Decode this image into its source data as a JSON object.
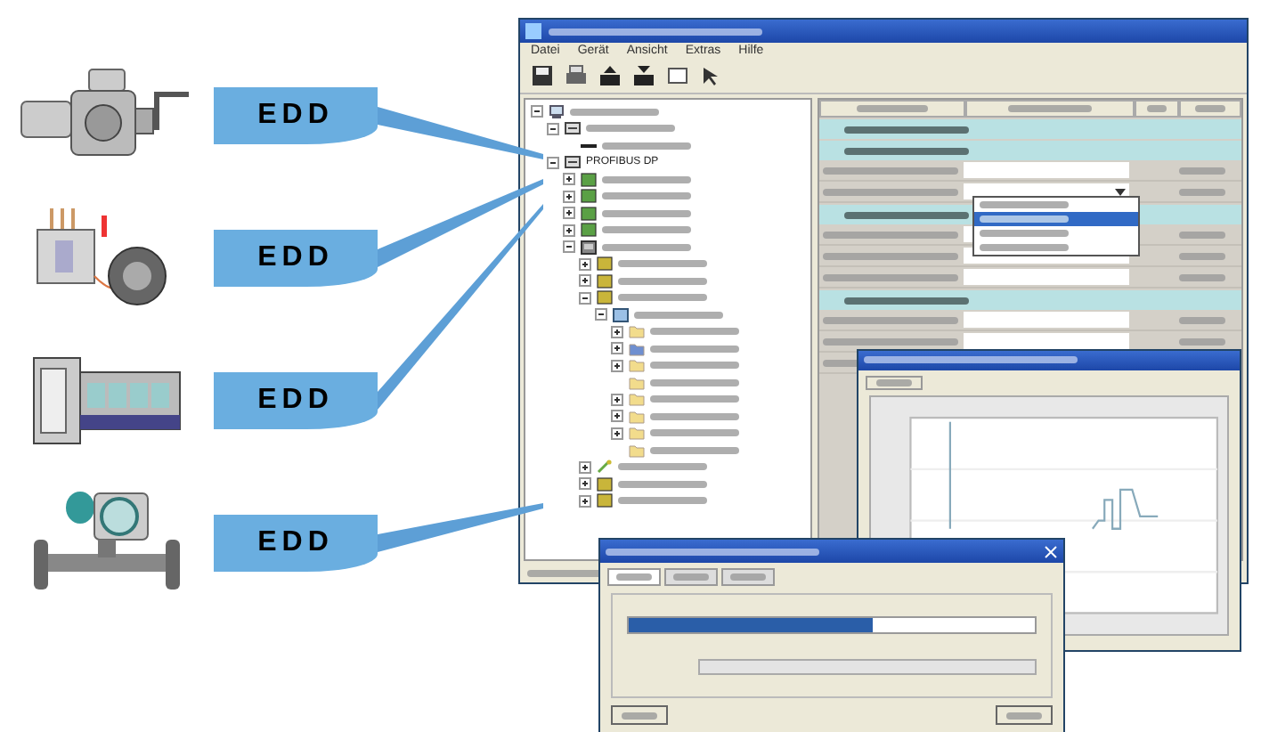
{
  "devices": [
    {
      "kind": "actuator",
      "label": "EDD"
    },
    {
      "kind": "motor-starter",
      "label": "EDD"
    },
    {
      "kind": "controller",
      "label": "EDD"
    },
    {
      "kind": "flowmeter",
      "label": "EDD"
    }
  ],
  "window": {
    "menu": [
      "Datei",
      "Gerät",
      "Ansicht",
      "Extras",
      "Hilfe"
    ],
    "tree": [
      {
        "kind": "computer",
        "expanded": true,
        "children": [
          {
            "kind": "network",
            "expanded": true,
            "children": [
              {
                "kind": "cable"
              }
            ]
          },
          {
            "kind": "network",
            "label": "PROFIBUS DP",
            "expanded": true,
            "children": [
              {
                "kind": "device",
                "expanded": false
              },
              {
                "kind": "device",
                "expanded": false
              },
              {
                "kind": "device",
                "expanded": false
              },
              {
                "kind": "device",
                "expanded": false
              },
              {
                "kind": "station",
                "expanded": true,
                "children": [
                  {
                    "kind": "module",
                    "expanded": false
                  },
                  {
                    "kind": "module",
                    "expanded": false
                  },
                  {
                    "kind": "module",
                    "expanded": true,
                    "children": [
                      {
                        "kind": "slave",
                        "expanded": true,
                        "children": [
                          {
                            "kind": "folder",
                            "expanded": false
                          },
                          {
                            "kind": "blue-folder",
                            "expanded": false
                          },
                          {
                            "kind": "folder",
                            "expanded": false
                          },
                          {
                            "kind": "folder"
                          },
                          {
                            "kind": "folder",
                            "expanded": false
                          },
                          {
                            "kind": "folder",
                            "expanded": false
                          },
                          {
                            "kind": "folder",
                            "expanded": false
                          },
                          {
                            "kind": "folder"
                          }
                        ]
                      }
                    ]
                  },
                  {
                    "kind": "sensor",
                    "expanded": false
                  },
                  {
                    "kind": "module",
                    "expanded": false
                  },
                  {
                    "kind": "module",
                    "expanded": false
                  }
                ]
              }
            ]
          }
        ]
      }
    ],
    "params": [
      {
        "kind": "section"
      },
      {
        "kind": "section"
      },
      {
        "kind": "row"
      },
      {
        "kind": "dropdown"
      },
      {
        "kind": "section"
      },
      {
        "kind": "row"
      },
      {
        "kind": "row"
      },
      {
        "kind": "row"
      },
      {
        "kind": "section"
      },
      {
        "kind": "row"
      },
      {
        "kind": "row"
      },
      {
        "kind": "row"
      }
    ],
    "dropdown_options": [
      {
        "selected": false
      },
      {
        "selected": true
      },
      {
        "selected": false
      },
      {
        "selected": false
      }
    ]
  },
  "progress_dialog": {
    "tabs": [
      {
        "selected": true
      },
      {
        "selected": false
      },
      {
        "selected": false
      }
    ],
    "level": 0.6
  }
}
